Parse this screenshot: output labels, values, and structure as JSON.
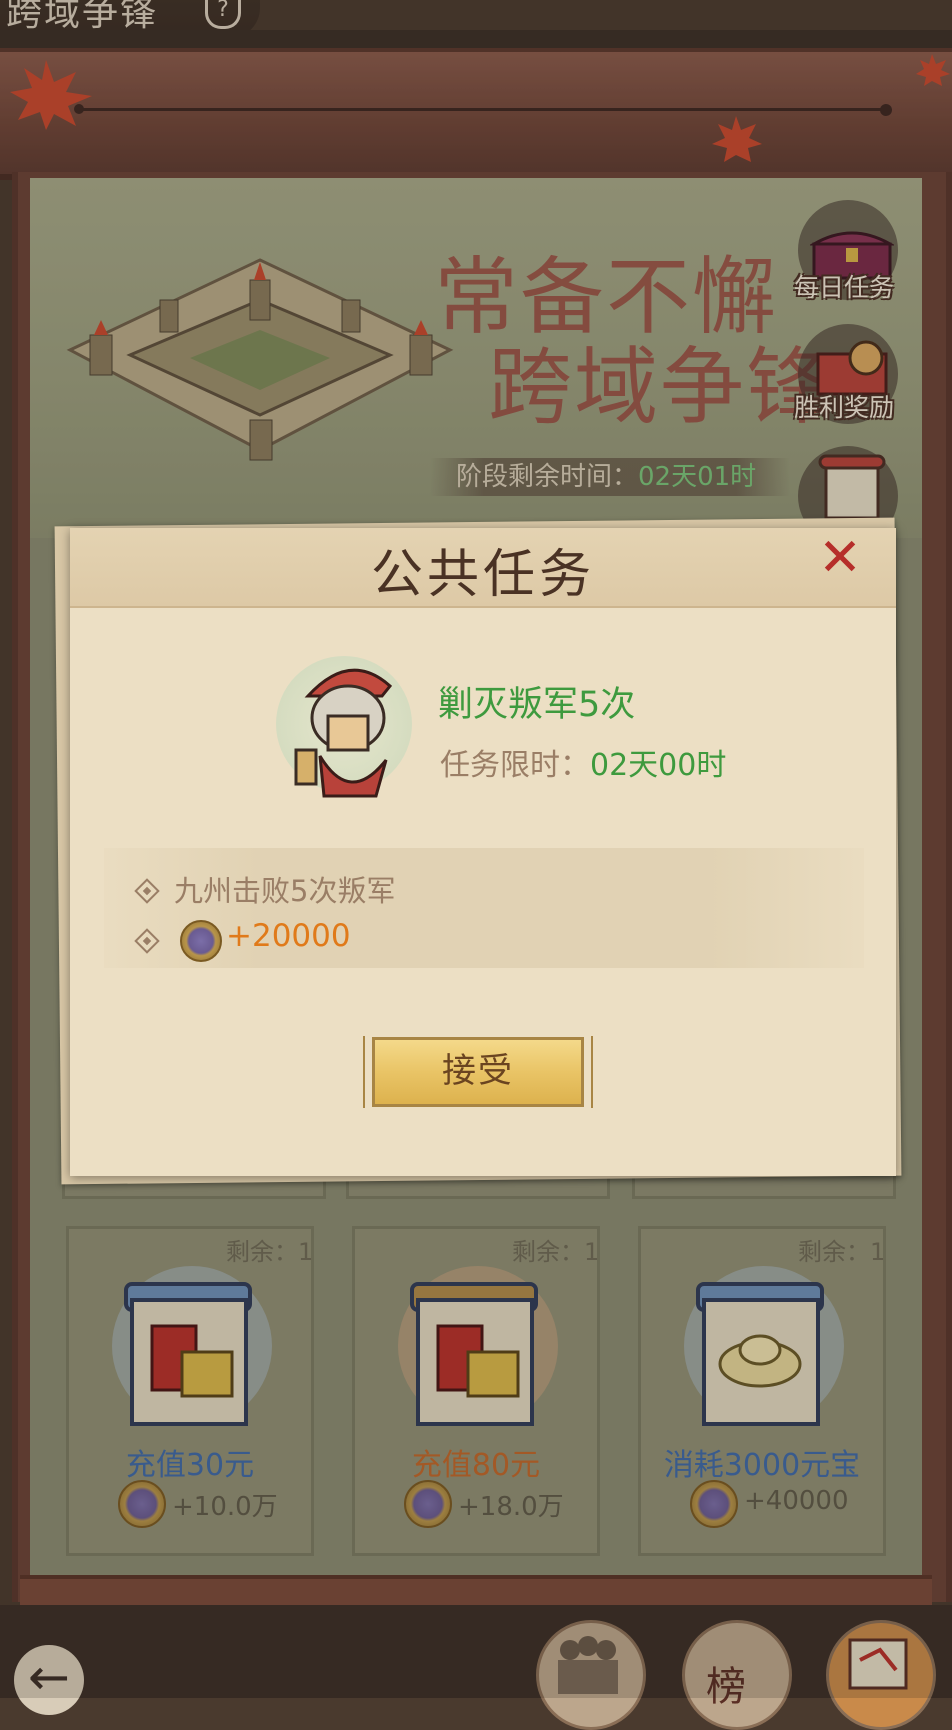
{
  "header": {
    "title": "跨域争锋",
    "help_symbol": "?"
  },
  "hero": {
    "slogan_line1": "常备不懈",
    "slogan_line2": "跨域争锋",
    "stage_time_label": "阶段剩余时间：",
    "stage_time_value": "02天01时"
  },
  "side_buttons": [
    {
      "label": "每日任务",
      "icon": "chest-icon"
    },
    {
      "label": "胜利奖励",
      "icon": "reward-icon"
    },
    {
      "label": "",
      "icon": "scroll-icon"
    }
  ],
  "modal": {
    "title": "公共任务",
    "close_symbol": "✕",
    "task_name": "剿灭叛军5次",
    "time_limit_label": "任务限时：",
    "time_limit_value": "02天00时",
    "requirement": "九州击败5次叛军",
    "reward": "+20000",
    "accept_label": "接受"
  },
  "cards": [
    {
      "remaining": "剩余：1",
      "label": "充值30元",
      "reward": "+10.0万",
      "label_color": "#3f6aa8",
      "circle_color": "#9ea6a0",
      "scroll_color": "#6d8fb8"
    },
    {
      "remaining": "剩余：1",
      "label": "充值80元",
      "reward": "+18.0万",
      "label_color": "#c0672a",
      "circle_color": "#b09a7a",
      "scroll_color": "#b08a4a"
    },
    {
      "remaining": "剩余：1",
      "label": "消耗3000元宝",
      "reward": "+40000",
      "label_color": "#3f6aa8",
      "circle_color": "#9ea6a0",
      "scroll_color": "#6d8fb8"
    }
  ],
  "bottom_nav": {
    "back_symbol": "←",
    "buttons": [
      {
        "label": "",
        "icon": "soldiers-icon"
      },
      {
        "label": "榜",
        "icon": "ranking-icon"
      },
      {
        "label": "",
        "icon": "map-scroll-icon"
      }
    ]
  }
}
